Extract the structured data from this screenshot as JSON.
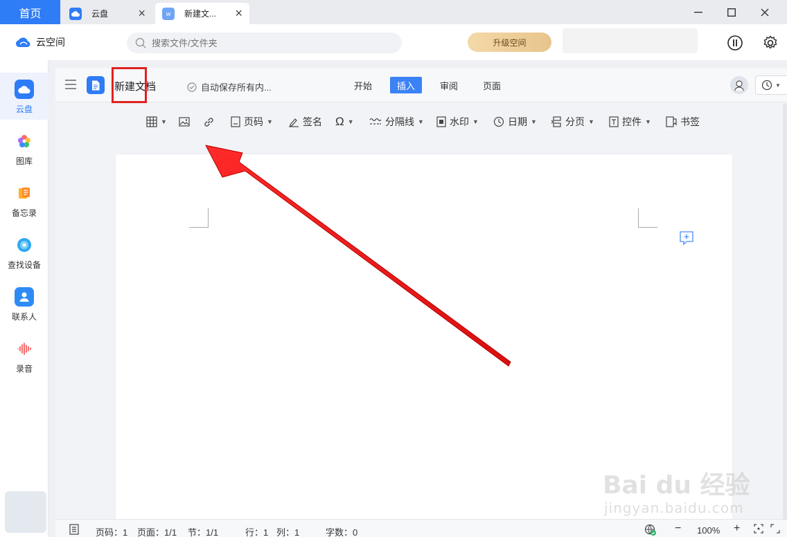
{
  "titlebar": {
    "home_tab": "首页",
    "tabs": [
      {
        "label": "云盘"
      },
      {
        "label": "新建文..."
      }
    ]
  },
  "appbar": {
    "brand": "云空间",
    "search_placeholder": "搜索文件/文件夹",
    "upgrade_label": "升级空间"
  },
  "sidebar": {
    "items": [
      {
        "label": "云盘"
      },
      {
        "label": "图库"
      },
      {
        "label": "备忘录"
      },
      {
        "label": "查找设备"
      },
      {
        "label": "联系人"
      },
      {
        "label": "录音"
      }
    ]
  },
  "document": {
    "title": "新建文档",
    "save_status": "自动保存所有内...",
    "menu_tabs": [
      {
        "label": "开始"
      },
      {
        "label": "插入"
      },
      {
        "label": "审阅"
      },
      {
        "label": "页面"
      }
    ],
    "active_tab": "插入"
  },
  "toolbar": {
    "page_number": "页码",
    "signature": "签名",
    "divider": "分隔线",
    "watermark": "水印",
    "date": "日期",
    "page_break": "分页",
    "control": "控件",
    "bookmark": "书签"
  },
  "statusbar": {
    "page_code": "页码：1",
    "pages": "页面：1/1",
    "section": "节：1/1",
    "row": "行：1",
    "col": "列：1",
    "word_count": "字数：0",
    "zoom": "100%"
  },
  "watermark": {
    "main": "Bai du 经验",
    "sub": "jingyan.baidu.com"
  },
  "colors": {
    "accent": "#2e7cf6",
    "annotation": "#e02020"
  }
}
